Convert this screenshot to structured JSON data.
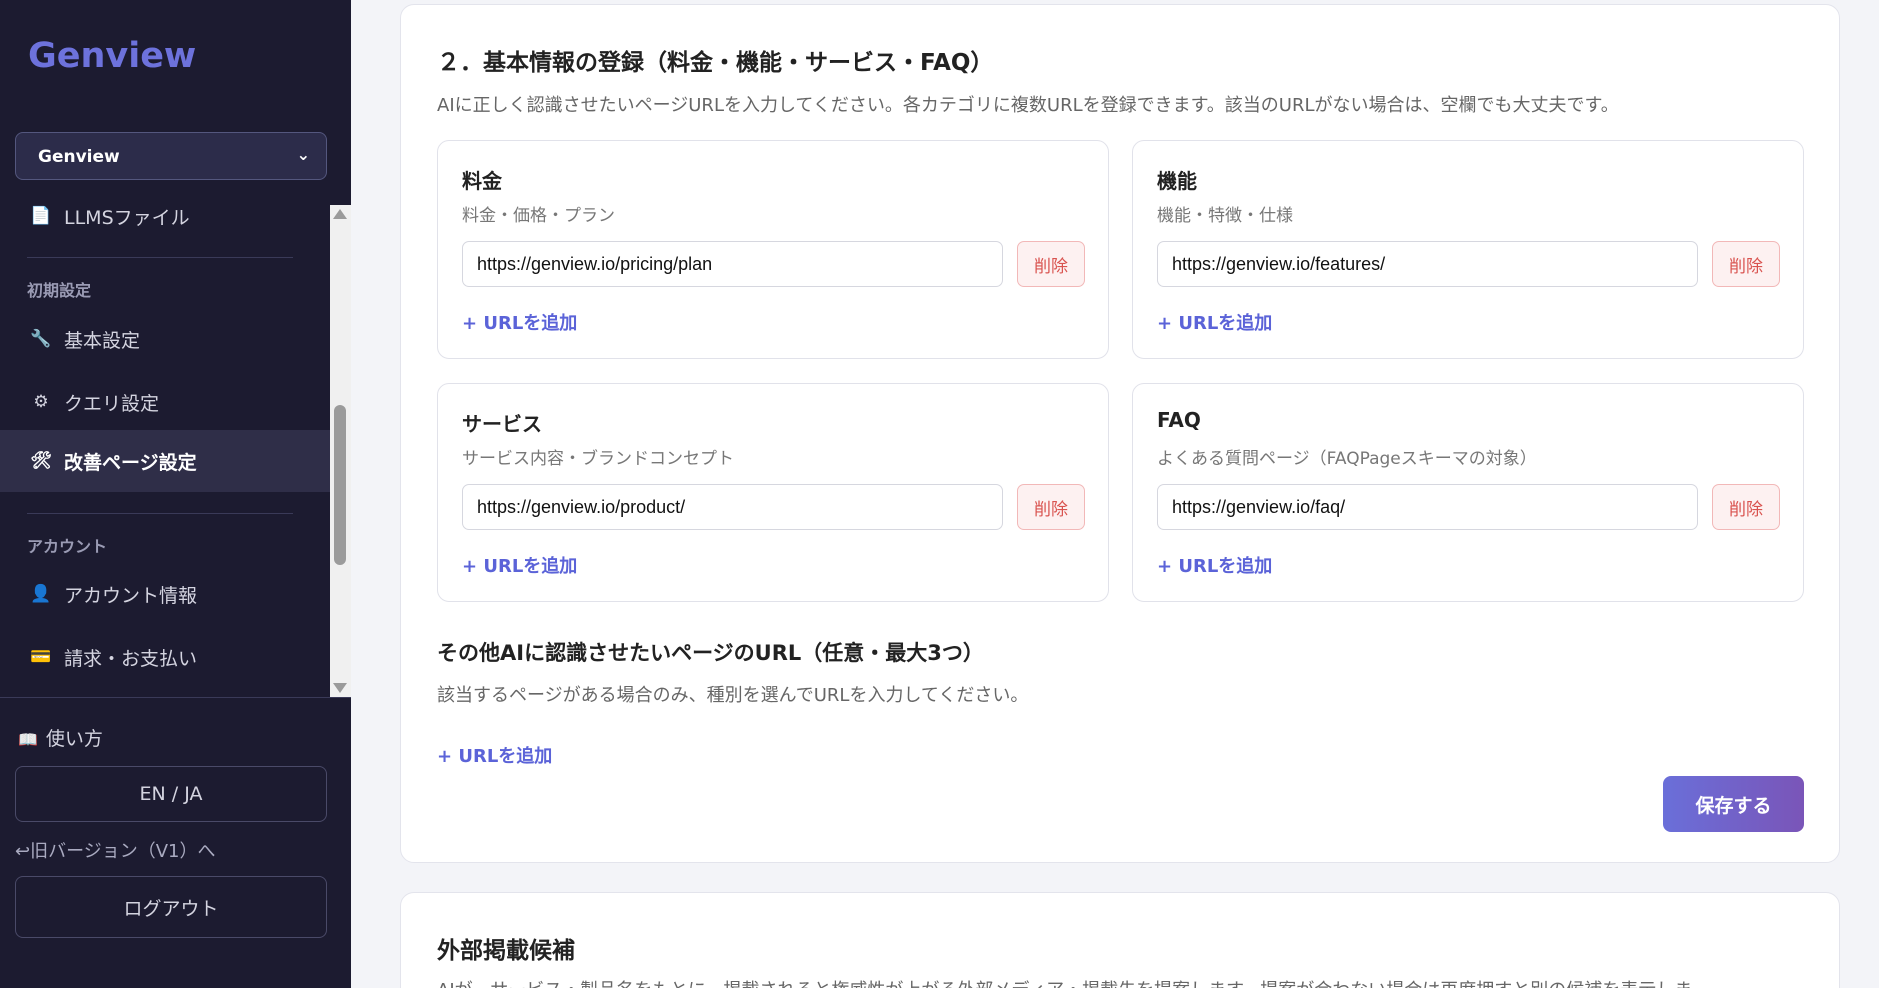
{
  "sidebar": {
    "brand": "Genview",
    "workspace": "Genview",
    "items": {
      "llms": {
        "label": "LLMSファイル",
        "icon": "document-icon"
      },
      "basic": {
        "label": "基本設定",
        "icon": "wrench-icon"
      },
      "query": {
        "label": "クエリ設定",
        "icon": "gear-icon"
      },
      "improve": {
        "label": "改善ページ設定",
        "icon": "tools-icon"
      },
      "account": {
        "label": "アカウント情報",
        "icon": "user-icon"
      },
      "billing": {
        "label": "請求・お支払い",
        "icon": "credit-card-icon"
      }
    },
    "sections": {
      "initial": "初期設定",
      "account": "アカウント"
    },
    "howto": "使い方",
    "lang": "EN / JA",
    "oldver": "↩旧バージョン（V1）へ",
    "logout": "ログアウト"
  },
  "section": {
    "title": "２．基本情報の登録（料金・機能・サービス・FAQ）",
    "desc": "AIに正しく認識させたいページURLを入力してください。各カテゴリに複数URLを登録できます。該当のURLがない場合は、空欄でも大丈夫です。"
  },
  "categories": {
    "pricing": {
      "title": "料金",
      "sub": "料金・価格・プラン",
      "url": "https://genview.io/pricing/plan",
      "delete": "削除",
      "add": "URLを追加"
    },
    "features": {
      "title": "機能",
      "sub": "機能・特徴・仕様",
      "url": "https://genview.io/features/",
      "delete": "削除",
      "add": "URLを追加"
    },
    "service": {
      "title": "サービス",
      "sub": "サービス内容・ブランドコンセプト",
      "url": "https://genview.io/product/",
      "delete": "削除",
      "add": "URLを追加"
    },
    "faq": {
      "title": "FAQ",
      "sub": "よくある質問ページ（FAQPageスキーマの対象）",
      "url": "https://genview.io/faq/",
      "delete": "削除",
      "add": "URLを追加"
    }
  },
  "other": {
    "title": "その他AIに認識させたいページのURL（任意・最大3つ）",
    "desc": "該当するページがある場合のみ、種別を選んでURLを入力してください。",
    "add": "URLを追加"
  },
  "save": "保存する",
  "external": {
    "title": "外部掲載候補",
    "desc": "AIが、サービス・製品名をもとに、掲載されると権威性が上がる外部メディア・掲載先を提案します。提案が合わない場合は再度押すと別の候補を表示しま"
  },
  "colors": {
    "sidebar": "#1c1b30",
    "accent": "#5b63d8",
    "danger": "#d9534f"
  }
}
